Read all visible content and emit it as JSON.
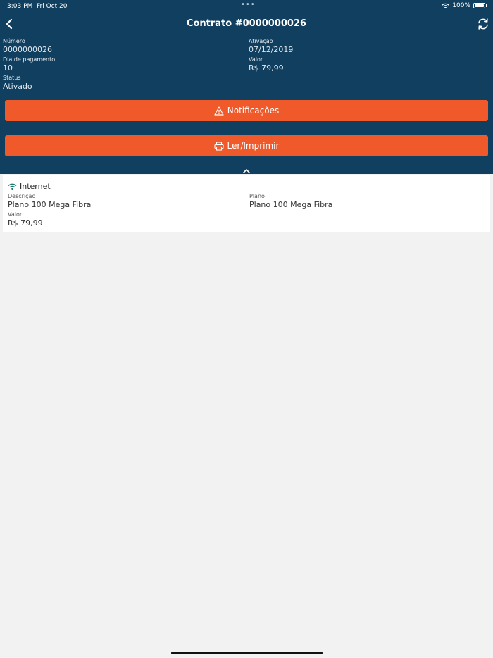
{
  "status_bar": {
    "time": "3:03 PM",
    "date": "Fri Oct 20",
    "battery": "100%"
  },
  "nav": {
    "title": "Contrato #0000000026"
  },
  "contract": {
    "numero_label": "Número",
    "numero": "0000000026",
    "ativacao_label": "Ativação",
    "ativacao": "07/12/2019",
    "dia_label": "Dia de pagamento",
    "dia": "10",
    "valor_label": "Valor",
    "valor": "R$ 79,99",
    "status_label": "Status",
    "status": "Ativado"
  },
  "buttons": {
    "notificacoes": "Notificações",
    "imprimir": "Ler/Imprimir"
  },
  "service": {
    "title": "Internet",
    "descricao_label": "Descrição",
    "descricao": "Plano 100 Mega Fibra",
    "plano_label": "Plano",
    "plano": "Plano 100 Mega Fibra",
    "valor_label": "Valor",
    "valor": "R$ 79,99"
  },
  "colors": {
    "header": "#113f5f",
    "accent": "#f05a2a",
    "background": "#f2f2f2",
    "wifi_icon": "#1f7a6e"
  }
}
